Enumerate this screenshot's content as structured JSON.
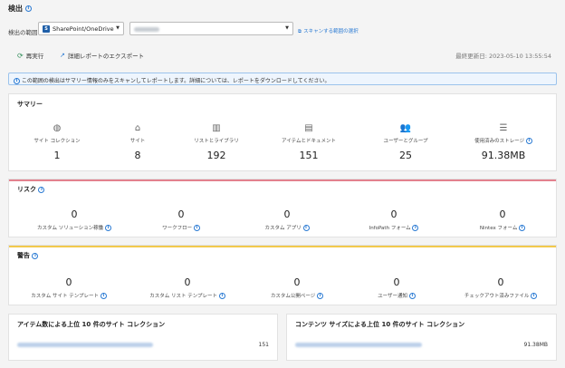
{
  "page": {
    "title": "検出"
  },
  "scan": {
    "label": "検出の範囲:",
    "scope_value": "SharePoint/OneDrive",
    "scan_link": "スキャンする範囲の選択"
  },
  "toolbar": {
    "rerun_label": "再実行",
    "export_label": "詳細レポートのエクスポート",
    "last_updated": "最終更新日: 2023-05-10 13:55:54"
  },
  "notice": {
    "text": "この範囲の検出はサマリー情報のみをスキャンしてレポートします。詳細については、レポートをダウンロードしてください。"
  },
  "summary": {
    "title": "サマリー",
    "items": [
      {
        "icon": "globe-icon",
        "label": "サイト コレクション",
        "value": "1"
      },
      {
        "icon": "home-icon",
        "label": "サイト",
        "value": "8"
      },
      {
        "icon": "library-icon",
        "label": "リストとライブラリ",
        "value": "192"
      },
      {
        "icon": "document-icon",
        "label": "アイテムとドキュメント",
        "value": "151"
      },
      {
        "icon": "users-icon",
        "label": "ユーザーとグループ",
        "value": "25"
      },
      {
        "icon": "database-icon",
        "label": "使用済みのストレージ",
        "value": "91.38MB"
      }
    ]
  },
  "risk": {
    "title": "リスク",
    "items": [
      {
        "label": "カスタム ソリューション稼働",
        "value": "0"
      },
      {
        "label": "ワークフロー",
        "value": "0"
      },
      {
        "label": "カスタム アプリ",
        "value": "0"
      },
      {
        "label": "InfoPath フォーム",
        "value": "0"
      },
      {
        "label": "Nintex フォーム",
        "value": "0"
      }
    ]
  },
  "warning": {
    "title": "警告",
    "items": [
      {
        "label": "カスタム サイト テンプレート",
        "value": "0"
      },
      {
        "label": "カスタム リスト テンプレート",
        "value": "0"
      },
      {
        "label": "カスタム公開ページ",
        "value": "0"
      },
      {
        "label": "ユーザー通知",
        "value": "0"
      },
      {
        "label": "チェックアウト済みファイル",
        "value": "0"
      }
    ]
  },
  "top_by_items": {
    "title": "アイテム数による上位 10 件のサイト コレクション",
    "value": "151"
  },
  "top_by_size": {
    "title": "コンテンツ サイズによる上位 10 件のサイト コレクション",
    "value": "91.38MB"
  },
  "colors": {
    "accent": "#2a7ad3",
    "risk": "#e3818e",
    "warning": "#f2c94c"
  }
}
